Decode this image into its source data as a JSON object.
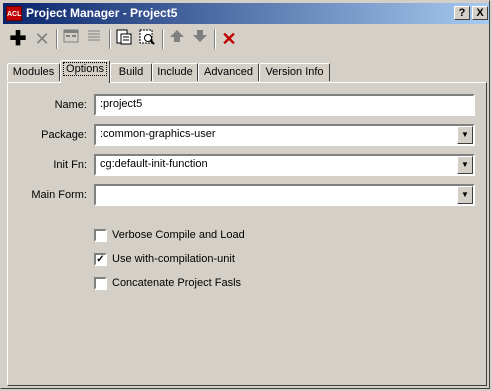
{
  "window": {
    "title": "Project Manager - Project5",
    "app_icon_text": "ACL"
  },
  "titlebar_buttons": {
    "help": "?",
    "close": "X"
  },
  "toolbar": {
    "add_icon": "plus-icon",
    "remove_icon": "x-icon",
    "view1_icon": "window-icon",
    "view2_icon": "list-icon",
    "open_icon": "open-file-icon",
    "inspect_icon": "inspect-icon",
    "up_icon": "arrow-up-icon",
    "down_icon": "arrow-down-icon",
    "delete_icon": "red-x-icon"
  },
  "tabs": [
    "Modules",
    "Options",
    "Build",
    "Include",
    "Advanced",
    "Version Info"
  ],
  "active_tab": "Options",
  "form": {
    "name": {
      "label": "Name:",
      "value": ":project5"
    },
    "package": {
      "label": "Package:",
      "value": ":common-graphics-user"
    },
    "init_fn": {
      "label": "Init Fn:",
      "value": "cg:default-init-function"
    },
    "main_form": {
      "label": "Main Form:",
      "value": ""
    }
  },
  "checkboxes": [
    {
      "label": "Verbose Compile and Load",
      "checked": false
    },
    {
      "label": "Use with-compilation-unit",
      "checked": true
    },
    {
      "label": "Concatenate Project Fasls",
      "checked": false
    }
  ]
}
